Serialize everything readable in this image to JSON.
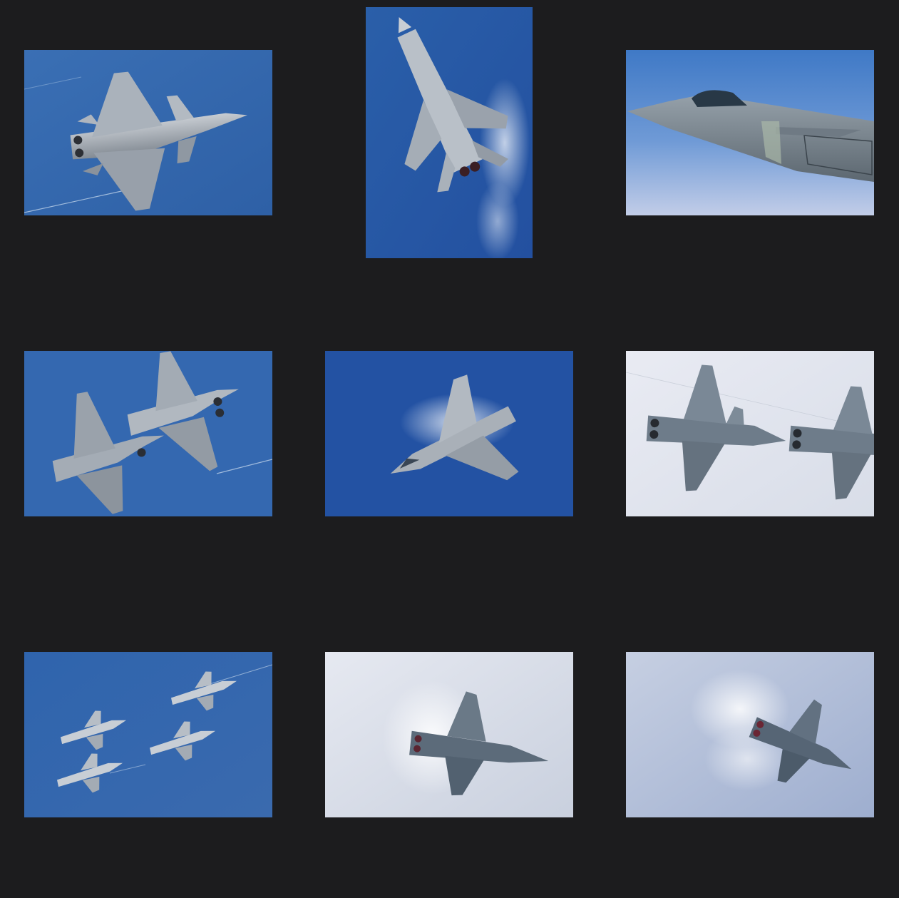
{
  "gallery": {
    "items": [
      {
        "subject": "fighter-jet-underside-banking",
        "sky": "blue"
      },
      {
        "subject": "fighter-jet-vertical-climb-vapor",
        "sky": "blue"
      },
      {
        "subject": "fighter-jet-cockpit-closeup",
        "sky": "blue-haze"
      },
      {
        "subject": "two-fighter-jets-formation",
        "sky": "blue"
      },
      {
        "subject": "fighter-jet-vapor-maneuver",
        "sky": "blue"
      },
      {
        "subject": "two-fighter-jets-overcast",
        "sky": "pale-grey"
      },
      {
        "subject": "four-fighter-jets-formation",
        "sky": "blue"
      },
      {
        "subject": "fighter-jet-vapor-cone",
        "sky": "pale-grey"
      },
      {
        "subject": "fighter-jet-afterburner-vapor",
        "sky": "pale-blue"
      }
    ]
  },
  "colors": {
    "background": "#1c1c1e",
    "sky_blue": "#2f63a8",
    "sky_pale": "#dfe4ee",
    "jet_grey": "#9aa3ad"
  }
}
